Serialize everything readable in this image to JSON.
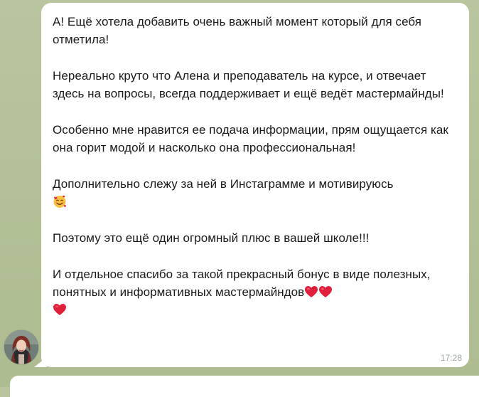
{
  "message": {
    "paragraphs": [
      "А! Ещё хотела добавить очень важный момент который для себя отметила!",
      "Нереально круто что Алена и преподаватель на курсе, и отвечает здесь на вопросы, всегда поддерживает и ещё ведёт мастермайнды!",
      "Особенно мне нравится ее подача информации, прям ощущается как она горит модой и насколько она профессиональная!",
      "Дополнительно слежу за ней в Инстаграмме и мотивируюсь",
      "Поэтому это ещё один огромный плюс в вашей школе!!!",
      "И отдельное спасибо за такой прекрасный бонус в виде полезных, понятных и информативных мастермайндов"
    ],
    "time": "17:28"
  },
  "icons": {
    "smiling_face_with_hearts": "smiling-face-with-hearts-emoji",
    "red_heart": "red-heart-emoji",
    "avatar": "sender-avatar"
  },
  "colors": {
    "chat_background": "#b5c29a",
    "bubble": "#ffffff",
    "timestamp": "#9aa4a9",
    "heart": "#e0203a"
  }
}
